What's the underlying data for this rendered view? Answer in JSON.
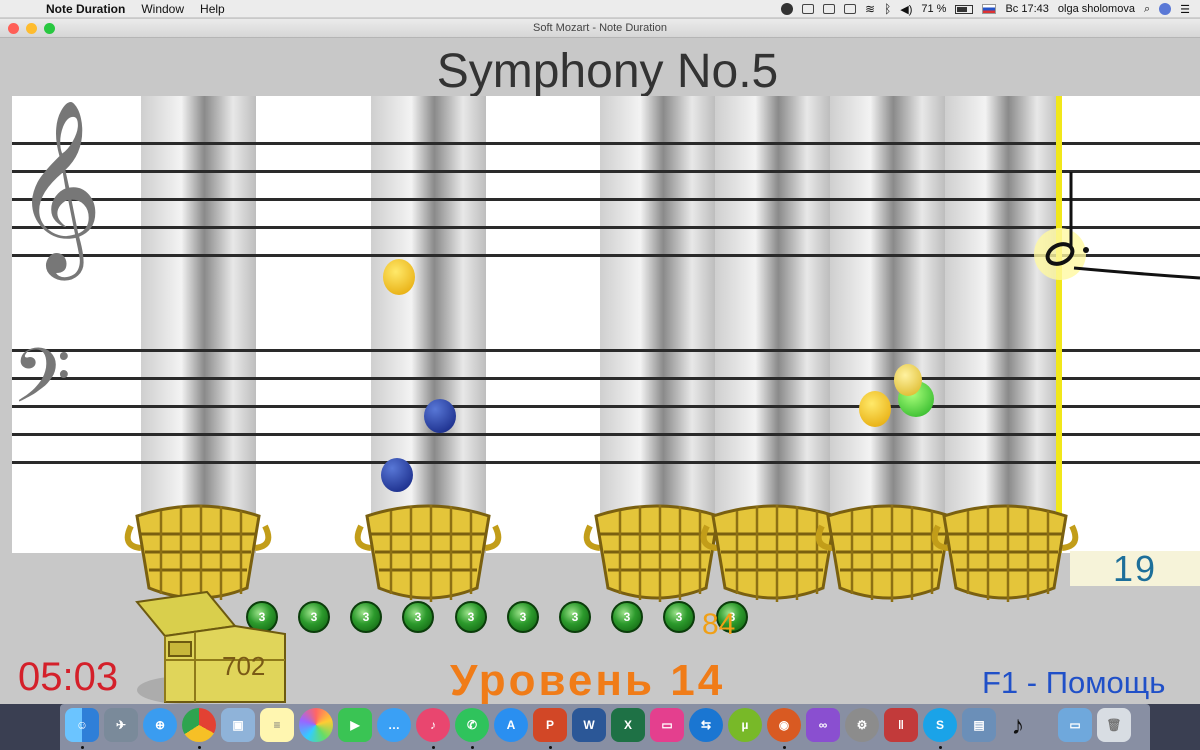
{
  "menubar": {
    "app_name": "Note Duration",
    "menus": [
      "Window",
      "Help"
    ],
    "battery": "71 %",
    "clock": "Вс 17:43",
    "user": "olga sholomova"
  },
  "window": {
    "title": "Soft Mozart - Note Duration"
  },
  "game": {
    "song_title": "Symphony No.5",
    "timer": "05:03",
    "level": "Уровень 14",
    "help": "F1 - Помощь",
    "treasure_score": "702",
    "coins_count": "84",
    "coin_label": "3",
    "notes_remaining": "19",
    "coins_shown": 10
  },
  "colors": {
    "timer": "#d4202a",
    "level": "#f07c18",
    "help": "#2050c8",
    "cursor": "#f1e71a",
    "coin": "#2c9a2c"
  },
  "dock": {
    "icons": [
      "finder-icon",
      "launchpad-icon",
      "safari-icon",
      "chrome-icon",
      "preview-icon",
      "notes-icon",
      "photos-icon",
      "facetime-icon",
      "messages-icon",
      "itunes-icon",
      "whatsapp-icon",
      "appstore-icon",
      "powerpoint-icon",
      "word-icon",
      "excel-icon",
      "screens-icon",
      "teamviewer-icon",
      "utorrent-icon",
      "game-icon",
      "visualstudio-icon",
      "system-preferences-icon",
      "parallels-icon",
      "skype-icon",
      "photos-viewer-icon",
      "music-note-icon",
      "folder-icon",
      "trash-icon"
    ]
  }
}
